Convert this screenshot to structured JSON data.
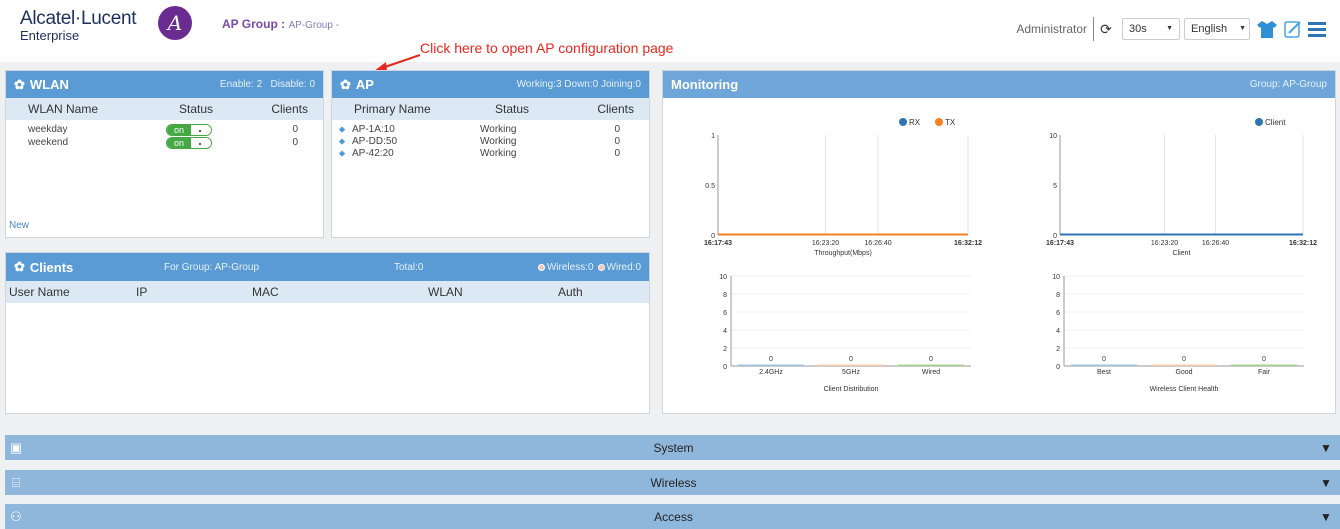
{
  "header": {
    "brand": "Alcatel·Lucent",
    "brand_sub": "Enterprise",
    "ap_group_label": "AP Group :",
    "ap_group_value": "AP-Group -",
    "annotation": "Click here to open AP configuration page",
    "user": "Administrator",
    "refresh_interval": "30s",
    "language": "English"
  },
  "wlan": {
    "title": "WLAN",
    "enable": "Enable: 2",
    "disable": "Disable: 0",
    "columns": [
      "WLAN Name",
      "Status",
      "Clients"
    ],
    "rows": [
      {
        "name": "weekday",
        "status": "on",
        "clients": "0"
      },
      {
        "name": "weekend",
        "status": "on",
        "clients": "0"
      }
    ],
    "new_link": "New"
  },
  "ap": {
    "title": "AP",
    "stats": "Working:3  Down:0  Joining:0",
    "columns": [
      "Primary Name",
      "Status",
      "Clients"
    ],
    "rows": [
      {
        "name": "AP-1A:10",
        "status": "Working",
        "clients": "0"
      },
      {
        "name": "AP-DD:50",
        "status": "Working",
        "clients": "0"
      },
      {
        "name": "AP-42:20",
        "status": "Working",
        "clients": "0"
      }
    ]
  },
  "clients": {
    "title": "Clients",
    "group": "For Group: AP-Group",
    "total": "Total:0",
    "wireless": "Wireless:0",
    "wired": "Wired:0",
    "columns": [
      "User Name",
      "IP",
      "MAC",
      "WLAN",
      "Auth"
    ]
  },
  "monitoring": {
    "title": "Monitoring",
    "group": "Group: AP-Group",
    "throughput": {
      "title": "Throughput(Mbps)",
      "legend": [
        "RX",
        "TX"
      ],
      "y_ticks": [
        "1",
        "0.5",
        "0"
      ],
      "x_ticks": [
        "16:17:43",
        "16:23:20",
        "16:26:40",
        "16:32:12"
      ],
      "colors": {
        "RX": "#2e75b6",
        "TX": "#f4801f"
      }
    },
    "client": {
      "title": "Client",
      "legend": [
        "Client"
      ],
      "y_ticks": [
        "10",
        "5",
        "0"
      ],
      "x_ticks": [
        "16:17:43",
        "16:23:20",
        "16:26:40",
        "16:32:12"
      ]
    },
    "distribution": {
      "title": "Client Distribution",
      "categories": [
        "2.4GHz",
        "5GHz",
        "Wired"
      ],
      "values": [
        0,
        0,
        0
      ],
      "y_ticks": [
        "10",
        "8",
        "6",
        "4",
        "2",
        "0"
      ]
    },
    "health": {
      "title": "Wireless Client Health",
      "categories": [
        "Best",
        "Good",
        "Fair"
      ],
      "values": [
        0,
        0,
        0
      ],
      "y_ticks": [
        "10",
        "8",
        "6",
        "4",
        "2",
        "0"
      ]
    }
  },
  "sections": [
    "System",
    "Wireless",
    "Access"
  ]
}
